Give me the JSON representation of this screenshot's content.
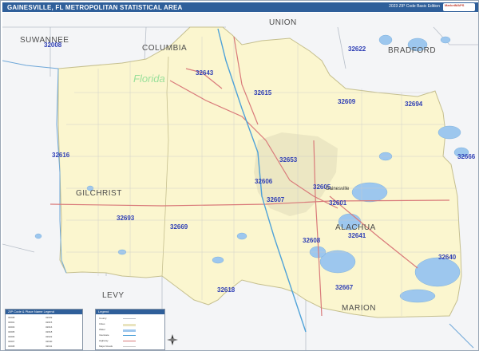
{
  "header": {
    "title": "GAINESVILLE, FL METROPOLITAN STATISTICAL AREA",
    "edition": "2023 ZIP Code Basic Edition",
    "logo_text": "MarketMAPS"
  },
  "map": {
    "state_label": "Florida",
    "counties": [
      {
        "name": "SUWANNEE"
      },
      {
        "name": "COLUMBIA"
      },
      {
        "name": "UNION"
      },
      {
        "name": "BRADFORD"
      },
      {
        "name": "GILCHRIST"
      },
      {
        "name": "ALACHUA"
      },
      {
        "name": "LEVY"
      },
      {
        "name": "MARION"
      }
    ],
    "zips": [
      "32008",
      "32643",
      "32622",
      "32615",
      "32609",
      "32694",
      "32616",
      "32653",
      "32666",
      "32606",
      "32605",
      "32607",
      "32601",
      "32693",
      "32669",
      "32641",
      "32608",
      "32640",
      "32618",
      "32667"
    ],
    "city": "Gainesville",
    "colors": {
      "msa_fill": "#fbf6cf",
      "outside_fill": "#f4f5f7",
      "water": "#9dc7ee",
      "highway": "#d97a7a",
      "zip_label": "#2f3fb5",
      "title_bar": "#2f5f9a"
    }
  },
  "legend_left": {
    "title": "ZIP Code & Place Name Legend",
    "rows": [
      "32008",
      "32601",
      "32603",
      "32605",
      "32606",
      "32607",
      "32608",
      "32609",
      "32615",
      "32616",
      "32618",
      "32622",
      "32640",
      "32641"
    ]
  },
  "legend_mid": {
    "title": "Legend",
    "items": [
      "County",
      "Cities",
      "Water",
      "Interstate",
      "Highway",
      "Major Roads"
    ]
  }
}
